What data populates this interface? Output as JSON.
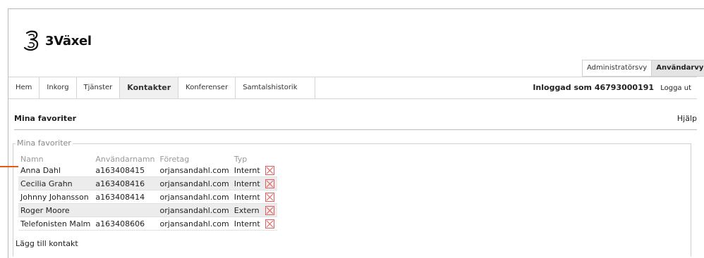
{
  "brand": {
    "name": "3Växel"
  },
  "view_switch": {
    "admin": "Administratörsvy",
    "user": "Användarvy"
  },
  "nav": {
    "items": [
      "Hem",
      "Inkorg",
      "Tjänster",
      "Kontakter",
      "Konferenser",
      "Samtalshistorik"
    ],
    "active": "Kontakter",
    "logged_in": "Inloggad som 46793000191",
    "logout": "Logga ut"
  },
  "section": {
    "title": "Mina favoriter",
    "help": "Hjälp"
  },
  "favorites": {
    "legend": "Mina favoriter",
    "columns": [
      "Namn",
      "Användarnamn",
      "Företag",
      "Typ"
    ],
    "rows": [
      {
        "name": "Anna Dahl",
        "username": "a163408415",
        "company": "orjansandahl.com",
        "type": "Internt"
      },
      {
        "name": "Cecilia Grahn",
        "username": "a163408416",
        "company": "orjansandahl.com",
        "type": "Internt"
      },
      {
        "name": "Johnny Johansson",
        "username": "a163408414",
        "company": "orjansandahl.com",
        "type": "Internt"
      },
      {
        "name": "Roger Moore",
        "username": "",
        "company": "orjansandahl.com",
        "type": "Extern"
      },
      {
        "name": "Telefonisten Malm",
        "username": "a163408606",
        "company": "orjansandahl.com",
        "type": "Internt"
      }
    ],
    "add_contact": "Lägg till kontakt"
  }
}
